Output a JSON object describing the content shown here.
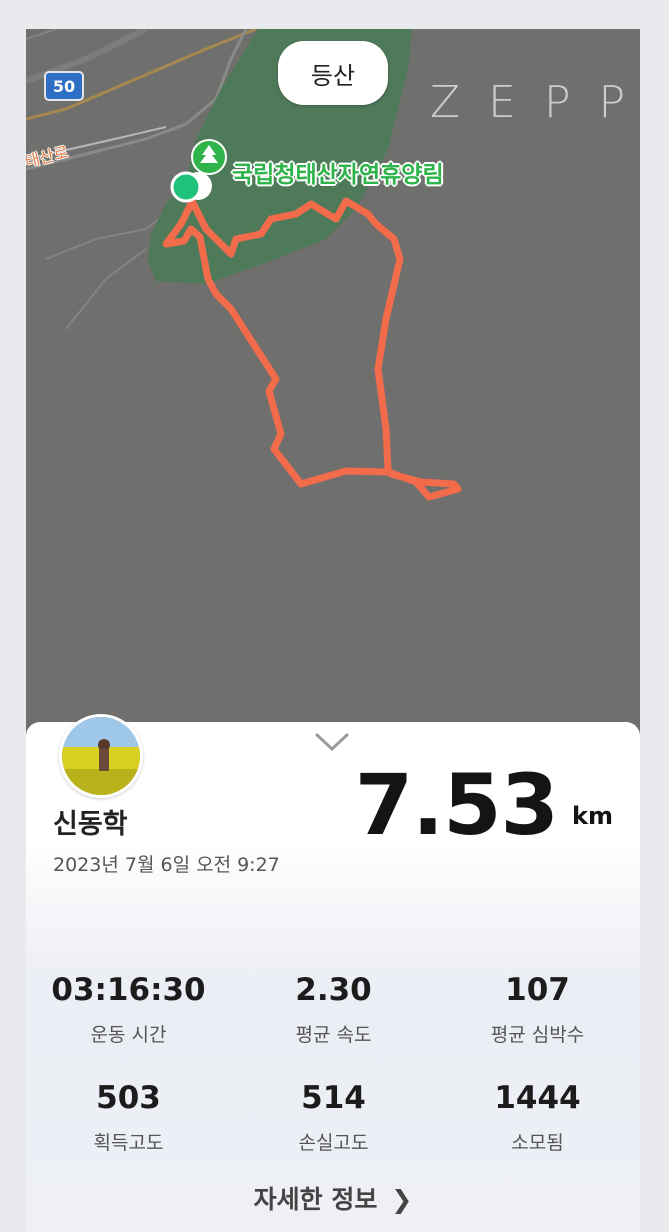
{
  "map": {
    "activity_type": "등산",
    "brand": "ZEPP",
    "poi_name": "국립청태산자연휴양림",
    "road_name": "태산로",
    "route_shield": "50",
    "route_color": "#f26b4b",
    "forest_color": "#4f7a5a",
    "start_marker_color": "#1ec27a"
  },
  "summary": {
    "user_name": "신동학",
    "date_time": "2023년 7월 6일 오전 9:27",
    "distance_value": "7.53",
    "distance_unit": "km"
  },
  "stats": [
    {
      "value": "03:16:30",
      "label": "운동 시간"
    },
    {
      "value": "2.30",
      "label": "평균 속도"
    },
    {
      "value": "107",
      "label": "평균 심박수"
    },
    {
      "value": "503",
      "label": "획득고도"
    },
    {
      "value": "514",
      "label": "손실고도"
    },
    {
      "value": "1444",
      "label": "소모됨"
    }
  ],
  "details_label": "자세한 정보"
}
